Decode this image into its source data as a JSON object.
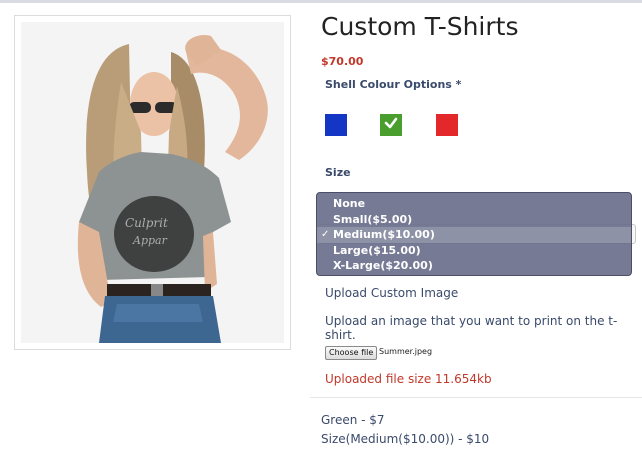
{
  "product": {
    "title": "Custom T-Shirts",
    "price": "$70.00",
    "image": "woman-in-grey-graphic-tshirt-photo"
  },
  "shell_colour": {
    "label": "Shell Colour Options *",
    "options": [
      {
        "name": "Blue",
        "color": "#1336c4",
        "selected": false
      },
      {
        "name": "Green",
        "color": "#4a9e2d",
        "selected": true
      },
      {
        "name": "Red",
        "color": "#e2282a",
        "selected": false
      }
    ]
  },
  "size": {
    "label": "Size",
    "options": [
      "None",
      "Small($5.00)",
      "Medium($10.00)",
      "Large($15.00)",
      "X-Large($20.00)"
    ],
    "selected": "Medium($10.00)",
    "check_glyph": "✓"
  },
  "upload": {
    "label": "Upload Custom Image",
    "help": "Upload an image that you want to print on the t-shirt.",
    "button": "Choose file",
    "filename": "Summer.jpeg",
    "size_text": "Uploaded file size 11.654kb"
  },
  "summary": {
    "lines": [
      "Green - $7",
      "Size(Medium($10.00)) - $10"
    ]
  }
}
